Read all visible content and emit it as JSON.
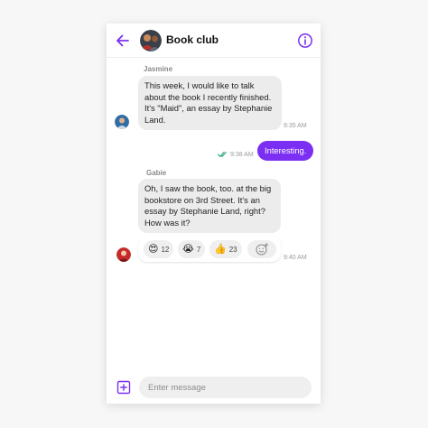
{
  "header": {
    "title": "Book club",
    "back_icon": "arrow-left-icon",
    "info_icon": "info-circle-icon"
  },
  "accent_color": "#7b2ff2",
  "messages": [
    {
      "sender": "Jasmine",
      "text": "This week, I would like to talk about the book I recently finished. It's \"Maid\", an essay by Stephanie Land.",
      "time": "9:35 AM"
    },
    {
      "text": "Interesting.",
      "time": "9:38 AM",
      "status_icon": "double-check-icon"
    },
    {
      "sender": "Gabie",
      "text": "Oh, I saw the book, too. at the big bookstore on 3rd Street. It's an essay by Stephanie Land, right? How was it?",
      "time": "9:40 AM",
      "reactions": [
        {
          "emoji": "😍",
          "count": "12"
        },
        {
          "emoji": "😭",
          "count": "7"
        },
        {
          "emoji": "👍",
          "count": "23"
        }
      ],
      "add_reaction_icon": "add-emoji-icon"
    }
  ],
  "composer": {
    "placeholder": "Enter message",
    "attach_icon": "plus-square-icon"
  }
}
